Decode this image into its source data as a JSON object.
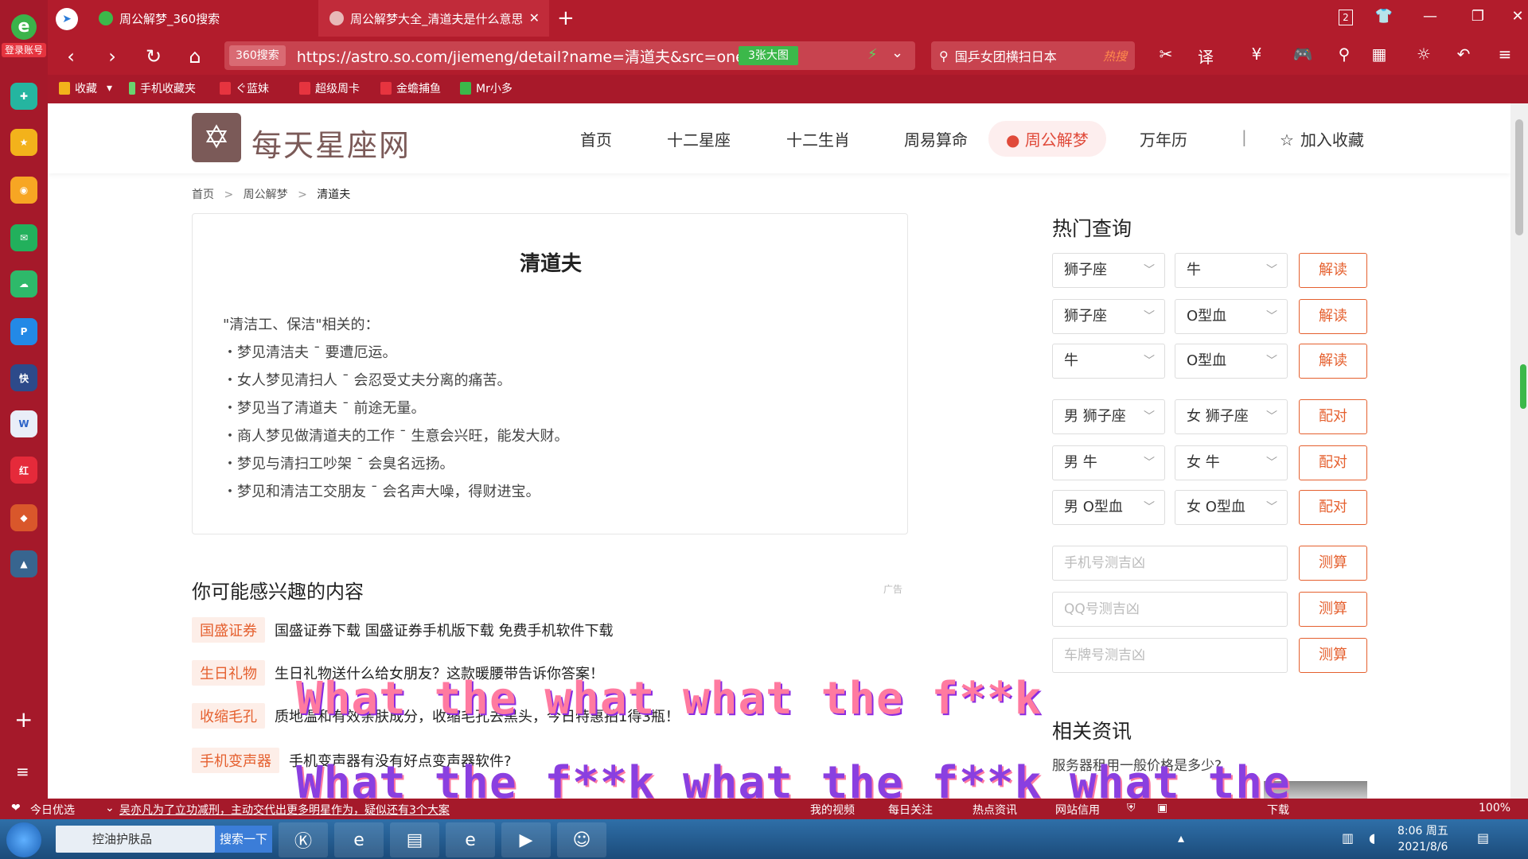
{
  "browser": {
    "tabs": [
      {
        "label": "周公解梦_360搜索"
      },
      {
        "label": "周公解梦大全_清道夫是什么意思"
      }
    ],
    "tab_count": "2",
    "url_badge": "360搜索",
    "url": "https://astro.so.com/jiemeng/detail?name=清道夫&src=onet",
    "image_btn": "3张大图",
    "search_text": "国乒女团横扫日本",
    "search_hot": "热搜",
    "login_label": "登录账号",
    "favorites": [
      "收藏",
      "手机收藏夹",
      "ぐ蓝妹",
      "超级周卡",
      "金蟾捕鱼",
      "Mr小多"
    ]
  },
  "site": {
    "name": "每天星座网",
    "nav": [
      "首页",
      "十二星座",
      "十二生肖",
      "周易算命",
      "周公解梦",
      "万年历",
      "加入收藏"
    ],
    "separator": "|"
  },
  "breadcrumb": [
    "首页",
    ">",
    "周公解梦",
    ">",
    "清道夫"
  ],
  "article": {
    "title": "清道夫",
    "intro": "\"清洁工、保洁\"相关的：",
    "items": [
      "・梦见清洁夫 ¯ 要遭厄运。",
      "・女人梦见清扫人 ¯ 会忍受丈夫分离的痛苦。",
      "・梦见当了清道夫 ¯ 前途无量。",
      "・商人梦见做清道夫的工作 ¯ 生意会兴旺，能发大财。",
      "・梦见与清扫工吵架 ¯ 会臭名远扬。",
      "・梦见和清洁工交朋友 ¯ 会名声大噪，得财进宝。"
    ]
  },
  "interest": {
    "title": "你可能感兴趣的内容",
    "ad_label": "广告",
    "items": [
      {
        "tag": "国盛证券",
        "text": "国盛证券下载 国盛证券手机版下载 免费手机软件下载"
      },
      {
        "tag": "生日礼物",
        "text": "生日礼物送什么给女朋友？这款暖腰带告诉你答案！"
      },
      {
        "tag": "收缩毛孔",
        "text": "质地温和有效亲肤成分，收缩毛孔去黑头，今日特惠拍1得3瓶！"
      },
      {
        "tag": "手机变声器",
        "text": "手机变声器有没有好点变声器软件?"
      }
    ]
  },
  "hot": {
    "title": "热门查询",
    "rows": [
      {
        "a": "狮子座",
        "b": "牛",
        "btn": "解读"
      },
      {
        "a": "狮子座",
        "b": "O型血",
        "btn": "解读"
      },
      {
        "a": "牛",
        "b": "O型血",
        "btn": "解读"
      },
      {
        "a": "男 狮子座",
        "b": "女 狮子座",
        "btn": "配对"
      },
      {
        "a": "男 牛",
        "b": "女 牛",
        "btn": "配对"
      },
      {
        "a": "男 O型血",
        "b": "女 O型血",
        "btn": "配对"
      }
    ],
    "inputs": [
      {
        "placeholder": "手机号测吉凶",
        "btn": "测算"
      },
      {
        "placeholder": "QQ号测吉凶",
        "btn": "测算"
      },
      {
        "placeholder": "车牌号测吉凶",
        "btn": "测算"
      }
    ]
  },
  "news": {
    "title": "相关资讯",
    "first": "服务器租用一般价格是多少?"
  },
  "danmaku": [
    "What the what what the f**k",
    "What the f**k what the f**k what the"
  ],
  "statusbar": {
    "left": "今日优选",
    "headline": "吴亦凡为了立功减刑，主动交代出更多明星作为，疑似还有3个大案",
    "items": [
      "我的视频",
      "每日关注",
      "热点资讯",
      "网站信用",
      "下载"
    ],
    "zoom": "100%"
  },
  "taskbar": {
    "search_text": "控油护肤品",
    "search_btn": "搜索一下",
    "time": "8:06 周五",
    "date": "2021/8/6"
  },
  "colors": {
    "brand": "#7b5a58",
    "accent": "#e5602f",
    "browser": "#b21c2c"
  }
}
